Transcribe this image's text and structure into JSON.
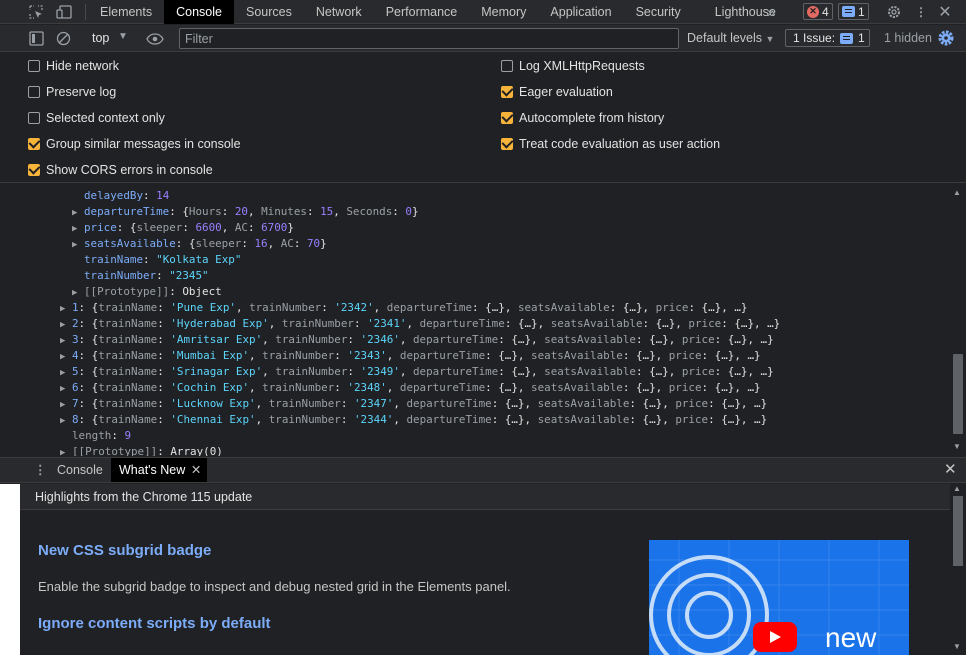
{
  "tabs": [
    "Elements",
    "Console",
    "Sources",
    "Network",
    "Performance",
    "Memory",
    "Application",
    "Security",
    "Lighthouse"
  ],
  "tab_active": "Console",
  "more_tabs_icon": "double-chevron-right",
  "status": {
    "errors": "4",
    "messages": "1"
  },
  "filter_bar": {
    "context": "top",
    "filter_placeholder": "Filter",
    "levels": "Default levels",
    "issues_label": "1 Issue:",
    "issues_count": "1",
    "hidden": "1 hidden"
  },
  "settings": {
    "left": [
      {
        "label": "Hide network",
        "checked": false
      },
      {
        "label": "Preserve log",
        "checked": false
      },
      {
        "label": "Selected context only",
        "checked": false
      },
      {
        "label": "Group similar messages in console",
        "checked": true
      },
      {
        "label": "Show CORS errors in console",
        "checked": true
      }
    ],
    "right": [
      {
        "label": "Log XMLHttpRequests",
        "checked": false
      },
      {
        "label": "Eager evaluation",
        "checked": true
      },
      {
        "label": "Autocomplete from history",
        "checked": true
      },
      {
        "label": "Treat code evaluation as user action",
        "checked": true
      }
    ]
  },
  "console": {
    "object_props": {
      "delayedBy": {
        "key": "delayedBy",
        "value": "14"
      },
      "departureTime": {
        "key": "departureTime",
        "hours": "20",
        "minutes": "15",
        "seconds": "0"
      },
      "price": {
        "key": "price",
        "sleeper": "6600",
        "ac": "6700"
      },
      "seats": {
        "key": "seatsAvailable",
        "sleeper": "16",
        "ac": "70"
      },
      "trainName": {
        "key": "trainName",
        "value": "\"Kolkata Exp\""
      },
      "trainNumber": {
        "key": "trainNumber",
        "value": "\"2345\""
      },
      "proto": {
        "key": "[[Prototype]]",
        "value": "Object"
      }
    },
    "array_items": [
      {
        "index": "1",
        "name": "'Pune Exp'",
        "number": "'2342'",
        "order": "dt_first"
      },
      {
        "index": "2",
        "name": "'Hyderabad Exp'",
        "number": "'2341'",
        "order": "dt_first"
      },
      {
        "index": "3",
        "name": "'Amritsar Exp'",
        "number": "'2346'",
        "order": "dt_first"
      },
      {
        "index": "4",
        "name": "'Mumbai Exp'",
        "number": "'2343'",
        "order": "dt_first"
      },
      {
        "index": "5",
        "name": "'Srinagar Exp'",
        "number": "'2349'",
        "order": "dt_first"
      },
      {
        "index": "6",
        "name": "'Cochin Exp'",
        "number": "'2348'",
        "order": "dt_first"
      },
      {
        "index": "7",
        "name": "'Lucknow Exp'",
        "number": "'2347'",
        "order": "dt_first"
      },
      {
        "index": "8",
        "name": "'Chennai Exp'",
        "number": "'2344'",
        "order": "dt_first"
      }
    ],
    "length": {
      "key": "length",
      "value": "9"
    },
    "array_proto": {
      "key": "[[Prototype]]",
      "value": "Array(0)"
    }
  },
  "drawer": {
    "tabs": [
      "Console",
      "What's New"
    ],
    "active": "What's New",
    "header": "Highlights from the Chrome 115 update",
    "items": [
      {
        "title": "New CSS subgrid badge",
        "desc": "Enable the subgrid badge to inspect and debug nested grid in the Elements panel."
      },
      {
        "title": "Ignore content scripts by default"
      }
    ],
    "video_text": "new"
  },
  "colors": {
    "accent_blue": "#7cacf8",
    "checkbox_on": "#f7b33a",
    "string": "#5cd5fb",
    "number": "#9980ff",
    "error": "#e46962"
  }
}
